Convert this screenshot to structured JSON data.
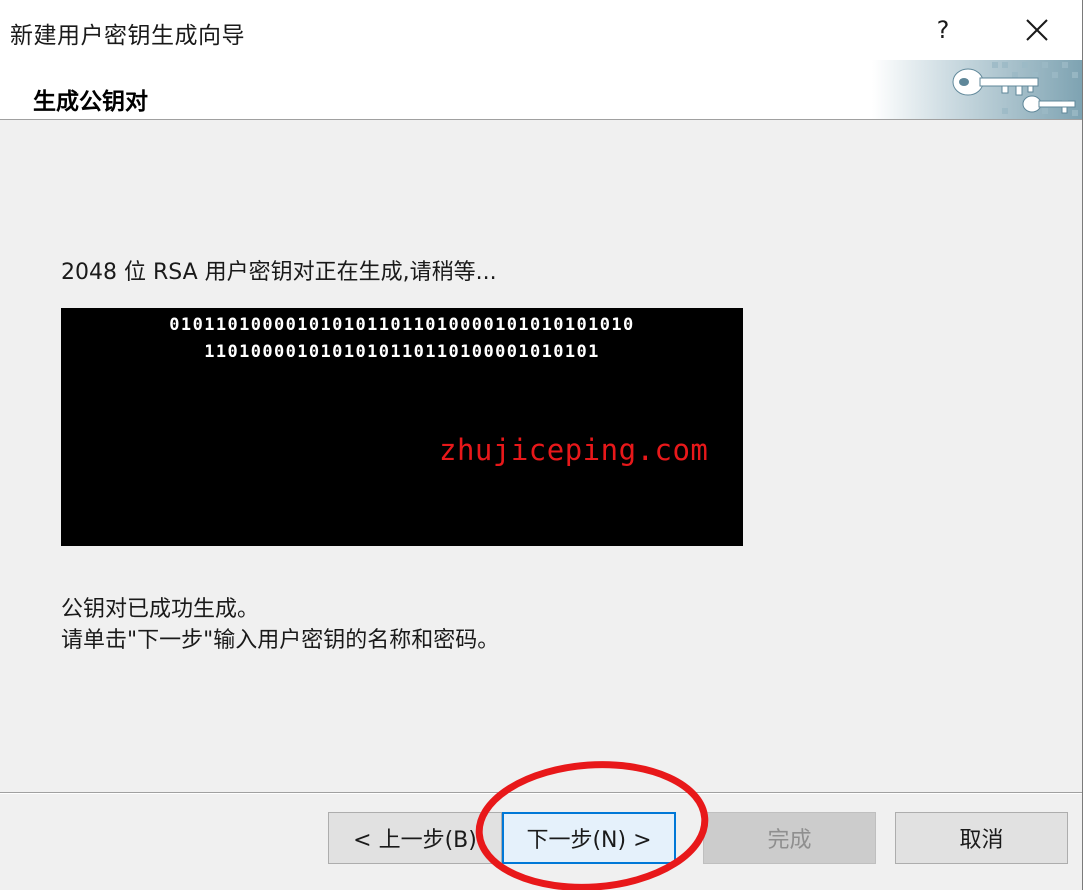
{
  "window": {
    "title": "新建用户密钥生成向导",
    "help_label": "?"
  },
  "header": {
    "title": "生成公钥对"
  },
  "content": {
    "status": "2048 位 RSA 用户密钥对正在生成,请稍等...",
    "bits_line1": "0101101000010101011011010000101010101010",
    "bits_line2": "1101000010101010110110100001010101",
    "watermark": "zhujiceping.com",
    "done_line1": "公钥对已成功生成。",
    "done_line2": "请单击\"下一步\"输入用户密钥的名称和密码。"
  },
  "buttons": {
    "back": "< 上一步(B)",
    "next": "下一步(N) >",
    "finish": "完成",
    "cancel": "取消"
  },
  "colors": {
    "accent": "#0078d7",
    "annotation": "#e8181a",
    "console_bg": "#000000",
    "dialog_bg": "#f0f0f0"
  },
  "icons": {
    "close": "close-icon",
    "help": "help-icon",
    "header": "keys-icon"
  }
}
